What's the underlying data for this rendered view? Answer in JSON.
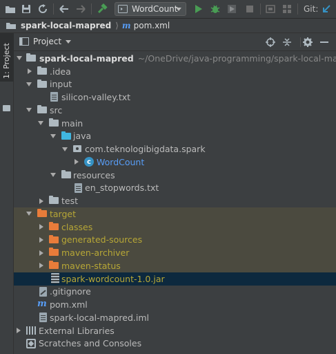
{
  "toolbar": {
    "run_config": "WordCount",
    "git_label": "Git:"
  },
  "breadcrumb": {
    "project": "spark-local-mapred",
    "file": "pom.xml"
  },
  "side_stripe": {
    "project_tab": "1: Project"
  },
  "panel": {
    "title": "Project"
  },
  "tree": {
    "root": {
      "name": "spark-local-mapred",
      "path": "~/OneDrive/java-programming/spark-local-mapred"
    },
    "idea": ".idea",
    "input": "input",
    "silicon": "silicon-valley.txt",
    "src": "src",
    "main": "main",
    "java": "java",
    "package": "com.teknologibigdata.spark",
    "wordcount": "WordCount",
    "resources": "resources",
    "stopwords": "en_stopwords.txt",
    "test": "test",
    "target": "target",
    "classes": "classes",
    "generated_sources": "generated-sources",
    "maven_archiver": "maven-archiver",
    "maven_status": "maven-status",
    "jar": "spark-wordcount-1.0.jar",
    "gitignore": ".gitignore",
    "pom": "pom.xml",
    "iml": "spark-local-mapred.iml",
    "external_libraries": "External Libraries",
    "scratches": "Scratches and Consoles"
  },
  "colors": {
    "background": "#3c3f41",
    "excluded_highlight": "#4b4a3f",
    "selection": "#0d293e",
    "excluded_text": "#b7a736",
    "class_text": "#589df6",
    "run_green": "#499c54"
  }
}
